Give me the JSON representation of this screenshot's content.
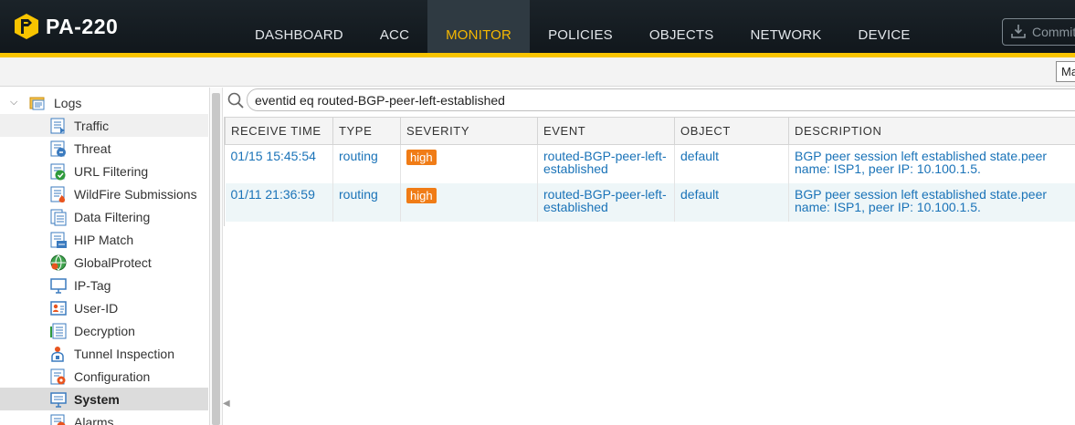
{
  "app": {
    "product": "PA-220",
    "nav": [
      {
        "label": "DASHBOARD",
        "active": false
      },
      {
        "label": "ACC",
        "active": false
      },
      {
        "label": "MONITOR",
        "active": true
      },
      {
        "label": "POLICIES",
        "active": false
      },
      {
        "label": "OBJECTS",
        "active": false
      },
      {
        "label": "NETWORK",
        "active": false
      },
      {
        "label": "DEVICE",
        "active": false
      }
    ],
    "commit_label": "Commit",
    "subbar_button": "Ma",
    "accent": "#f8c400",
    "active_tab_color": "#f6b800"
  },
  "sidebar": {
    "root_label": "Logs",
    "items": [
      {
        "label": "Traffic",
        "icon": "traffic-log-icon"
      },
      {
        "label": "Threat",
        "icon": "threat-log-icon"
      },
      {
        "label": "URL Filtering",
        "icon": "url-filtering-icon"
      },
      {
        "label": "WildFire Submissions",
        "icon": "wildfire-icon"
      },
      {
        "label": "Data Filtering",
        "icon": "data-filtering-icon"
      },
      {
        "label": "HIP Match",
        "icon": "hip-match-icon"
      },
      {
        "label": "GlobalProtect",
        "icon": "globalprotect-icon"
      },
      {
        "label": "IP-Tag",
        "icon": "ip-tag-icon"
      },
      {
        "label": "User-ID",
        "icon": "user-id-icon"
      },
      {
        "label": "Decryption",
        "icon": "decryption-icon"
      },
      {
        "label": "Tunnel Inspection",
        "icon": "tunnel-inspection-icon"
      },
      {
        "label": "Configuration",
        "icon": "configuration-icon"
      },
      {
        "label": "System",
        "icon": "system-icon",
        "selected": true
      },
      {
        "label": "Alarms",
        "icon": "alarms-icon"
      }
    ]
  },
  "search": {
    "value": "eventid eq routed-BGP-peer-left-established"
  },
  "table": {
    "columns": [
      "RECEIVE TIME",
      "TYPE",
      "SEVERITY",
      "EVENT",
      "OBJECT",
      "DESCRIPTION"
    ],
    "rows": [
      {
        "receive_time": "01/15 15:45:54",
        "type": "routing",
        "severity": "high",
        "event": "routed-BGP-peer-left-established",
        "object": "default",
        "description": "BGP peer session left established state.peer name: ISP1, peer IP: 10.100.1.5."
      },
      {
        "receive_time": "01/11 21:36:59",
        "type": "routing",
        "severity": "high",
        "event": "routed-BGP-peer-left-established",
        "object": "default",
        "description": "BGP peer session left established state.peer name: ISP1, peer IP: 10.100.1.5."
      }
    ],
    "severity_color": "#f07c16",
    "link_color": "#1a73b8"
  }
}
